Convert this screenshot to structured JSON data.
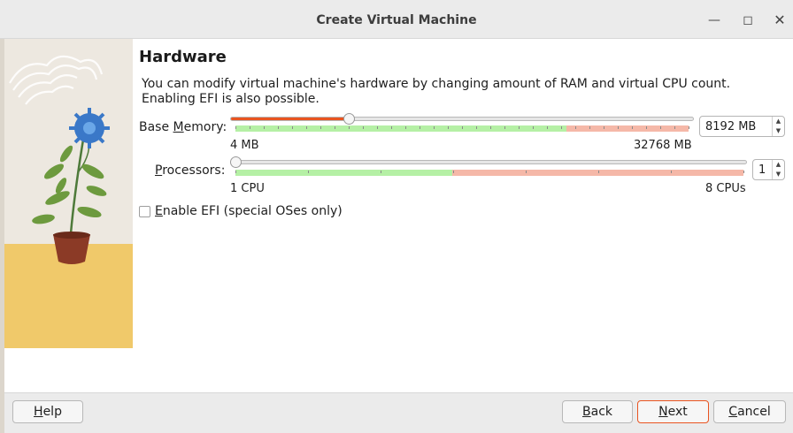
{
  "window": {
    "title": "Create Virtual Machine"
  },
  "page": {
    "heading": "Hardware",
    "description": "You can modify virtual machine's hardware by changing amount of RAM and virtual CPU count. Enabling EFI is also possible."
  },
  "memory": {
    "label_prefix": "Base ",
    "label_mnemonic": "M",
    "label_suffix": "emory:",
    "value": "8192 MB",
    "min_label": "4 MB",
    "max_label": "32768 MB",
    "fraction": 0.25
  },
  "processors": {
    "label_mnemonic": "P",
    "label_suffix": "rocessors:",
    "value": "1",
    "min_label": "1 CPU",
    "max_label": "8 CPUs",
    "fraction": 0.0
  },
  "efi": {
    "mnemonic": "E",
    "label_suffix": "nable EFI (special OSes only)",
    "checked": false
  },
  "buttons": {
    "help_mnemonic": "H",
    "help_suffix": "elp",
    "back_mnemonic": "B",
    "back_suffix": "ack",
    "next_mnemonic": "N",
    "next_suffix": "ext",
    "cancel_mnemonic": "C",
    "cancel_suffix": "ancel"
  },
  "icons": {
    "minimize": "minimize-icon",
    "maximize": "maximize-icon",
    "close": "close-icon",
    "spin_up": "spin-up-icon",
    "spin_down": "spin-down-icon"
  },
  "colors": {
    "accent": "#e95420",
    "safe_zone": "#b5f0a5",
    "warning_zone": "#f5b8a8"
  }
}
